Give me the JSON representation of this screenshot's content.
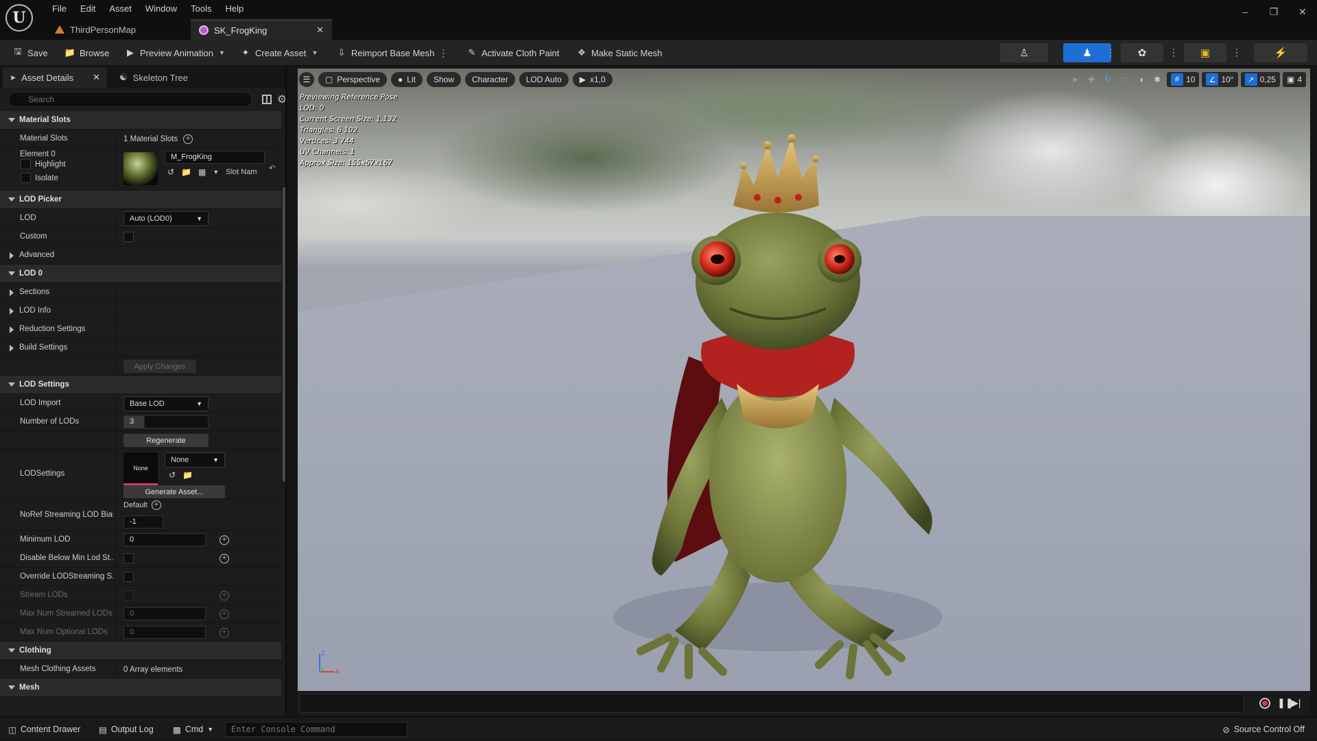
{
  "menu": [
    "File",
    "Edit",
    "Asset",
    "Window",
    "Tools",
    "Help"
  ],
  "tabs": {
    "map": "ThirdPersonMap",
    "asset": "SK_FrogKing"
  },
  "toolbar": {
    "save": "Save",
    "browse": "Browse",
    "preview_animation": "Preview Animation",
    "create_asset": "Create Asset",
    "reimport": "Reimport Base Mesh",
    "cloth_paint": "Activate Cloth Paint",
    "make_static": "Make Static Mesh"
  },
  "panel": {
    "tab_details": "Asset Details",
    "tab_skeleton": "Skeleton Tree",
    "search_placeholder": "Search"
  },
  "rows": {
    "material_slots_header": "Material Slots",
    "material_slots": "Material Slots",
    "material_slots_val": "1 Material Slots",
    "element0": "Element 0",
    "material_name": "M_FrogKing",
    "highlight": "Highlight",
    "isolate": "Isolate",
    "slot_name": "Slot Nam",
    "lod_picker": "LOD Picker",
    "lod": "LOD",
    "lod_val": "Auto (LOD0)",
    "custom": "Custom",
    "advanced": "Advanced",
    "lod0": "LOD 0",
    "sections": "Sections",
    "lod_info": "LOD Info",
    "reduction": "Reduction Settings",
    "build": "Build Settings",
    "apply_changes": "Apply Changes",
    "lod_settings": "LOD Settings",
    "lod_import": "LOD Import",
    "lod_import_val": "Base LOD",
    "num_lods": "Number of LODs",
    "num_lods_val": "3",
    "regenerate": "Regenerate",
    "lodsettings": "LODSettings",
    "lodsettings_val": "None",
    "swatch_none": "None",
    "generate_asset": "Generate Asset...",
    "noref": "NoRef Streaming LOD Bias",
    "default": "Default",
    "noref_val": "-1",
    "min_lod": "Minimum LOD",
    "min_lod_val": "0",
    "disable_below": "Disable Below Min Lod St...",
    "override": "Override LODStreaming S...",
    "stream_lods": "Stream LODs",
    "max_streamed": "Max Num Streamed LODs",
    "max_streamed_val": "0",
    "max_optional": "Max Num Optional LODs",
    "max_optional_val": "0",
    "clothing": "Clothing",
    "mesh_clothing": "Mesh Clothing Assets",
    "mesh_clothing_val": "0 Array elements",
    "mesh": "Mesh"
  },
  "viewport": {
    "perspective": "Perspective",
    "lit": "Lit",
    "show": "Show",
    "character": "Character",
    "lod_auto": "LOD Auto",
    "speed": "x1,0",
    "grid": "10",
    "angle": "10°",
    "scale": "0,25",
    "camera": "4",
    "info": [
      "Previewing Reference Pose",
      "LOD: 0",
      "Current Screen Size: 1,132",
      "Triangles: 6 102",
      "Vertices: 3 744",
      "UV Channels: 1",
      "Approx Size: 155x67x167"
    ]
  },
  "statusbar": {
    "content_drawer": "Content Drawer",
    "output_log": "Output Log",
    "cmd": "Cmd",
    "console_placeholder": "Enter Console Command",
    "source_control": "Source Control Off"
  }
}
